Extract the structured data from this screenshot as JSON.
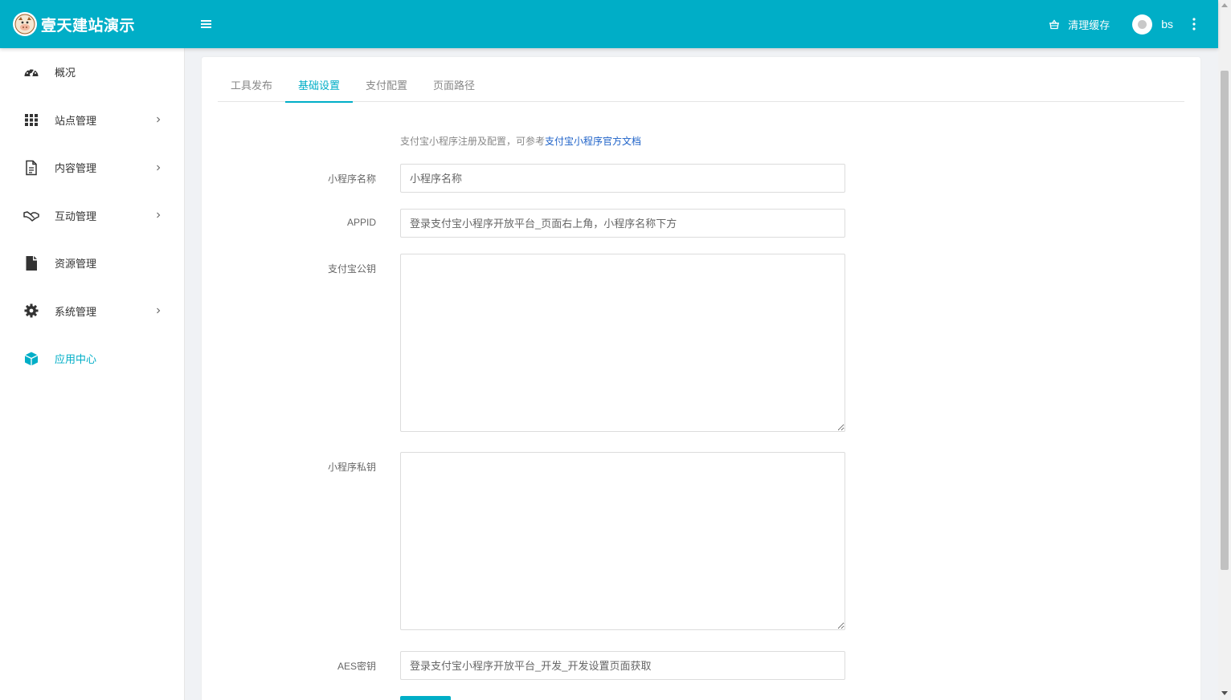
{
  "app": {
    "title": "壹天建站演示"
  },
  "header": {
    "clear_cache_label": "清理缓存",
    "username": "bs",
    "icons": {
      "logo": "cartoon-cow-logo",
      "menu": "hamburger-icon",
      "clear_cache": "basket-icon",
      "more": "kebab-icon"
    }
  },
  "sidebar": {
    "items": [
      {
        "label": "概况",
        "icon": "dashboard-gauge-icon",
        "has_children": false,
        "active": false
      },
      {
        "label": "站点管理",
        "icon": "grid-icon",
        "has_children": true,
        "active": false
      },
      {
        "label": "内容管理",
        "icon": "document-icon",
        "has_children": true,
        "active": false
      },
      {
        "label": "互动管理",
        "icon": "handshake-icon",
        "has_children": true,
        "active": false
      },
      {
        "label": "资源管理",
        "icon": "file-icon",
        "has_children": false,
        "active": false
      },
      {
        "label": "系统管理",
        "icon": "gear-icon",
        "has_children": true,
        "active": false
      },
      {
        "label": "应用中心",
        "icon": "cube-icon",
        "has_children": false,
        "active": true
      }
    ]
  },
  "tabs": [
    {
      "label": "工具发布",
      "active": false
    },
    {
      "label": "基础设置",
      "active": true
    },
    {
      "label": "支付配置",
      "active": false
    },
    {
      "label": "页面路径",
      "active": false
    }
  ],
  "form": {
    "hint_text": "支付宝小程序注册及配置，可参考",
    "hint_link": "支付宝小程序官方文档",
    "fields": {
      "name": {
        "label": "小程序名称",
        "placeholder": "小程序名称",
        "value": ""
      },
      "appid": {
        "label": "APPID",
        "placeholder": "登录支付宝小程序开放平台_页面右上角，小程序名称下方",
        "value": ""
      },
      "public_key": {
        "label": "支付宝公钥",
        "value": ""
      },
      "private_key": {
        "label": "小程序私钥",
        "value": ""
      },
      "aes_key": {
        "label": "AES密钥",
        "placeholder": "登录支付宝小程序开放平台_开发_开发设置页面获取",
        "value": ""
      }
    }
  },
  "colors": {
    "accent": "#00aec7",
    "link": "#1e62c8",
    "sidebar_text": "#333333"
  }
}
